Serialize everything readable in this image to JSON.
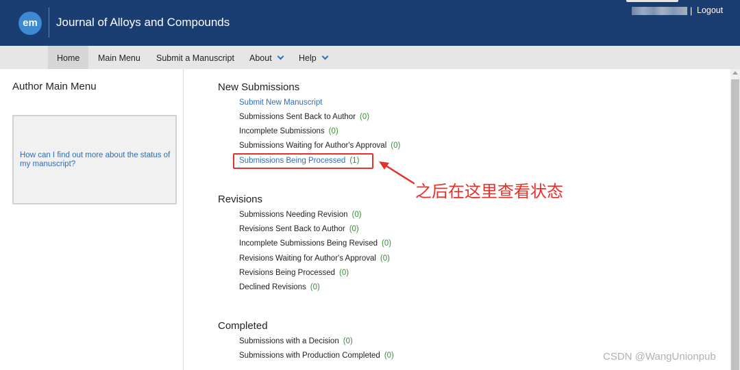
{
  "header": {
    "logo_text": "em",
    "journal_title": "Journal of Alloys and Compounds",
    "separator": "|",
    "logout_label": "Logout"
  },
  "nav": {
    "home": "Home",
    "main_menu": "Main Menu",
    "submit": "Submit a Manuscript",
    "about": "About",
    "help": "Help"
  },
  "left": {
    "title": "Author Main Menu",
    "help_link": "How can I find out more about the status of my manuscript?"
  },
  "new_submissions": {
    "title": "New Submissions",
    "submit_new": "Submit New Manuscript",
    "items": [
      {
        "label": "Submissions Sent Back to Author",
        "count": "(0)"
      },
      {
        "label": "Incomplete Submissions",
        "count": "(0)"
      },
      {
        "label": "Submissions Waiting for Author's Approval",
        "count": "(0)"
      },
      {
        "label": "Submissions Being Processed",
        "count": "(1)"
      }
    ]
  },
  "revisions": {
    "title": "Revisions",
    "items": [
      {
        "label": "Submissions Needing Revision",
        "count": "(0)"
      },
      {
        "label": "Revisions Sent Back to Author",
        "count": "(0)"
      },
      {
        "label": "Incomplete Submissions Being Revised",
        "count": "(0)"
      },
      {
        "label": "Revisions Waiting for Author's Approval",
        "count": "(0)"
      },
      {
        "label": "Revisions Being Processed",
        "count": "(0)"
      },
      {
        "label": "Declined Revisions",
        "count": "(0)"
      }
    ]
  },
  "completed": {
    "title": "Completed",
    "items": [
      {
        "label": "Submissions with a Decision",
        "count": "(0)"
      },
      {
        "label": "Submissions with Production Completed",
        "count": "(0)"
      }
    ]
  },
  "annotation": "之后在这里查看状态",
  "watermark": "CSDN @WangUnionpub",
  "colors": {
    "header_bg": "#1b3e72",
    "link": "#2f6db5",
    "count": "#3a8a3a",
    "annotation": "#e8302a",
    "navbar_bg": "#e6e6e6"
  }
}
